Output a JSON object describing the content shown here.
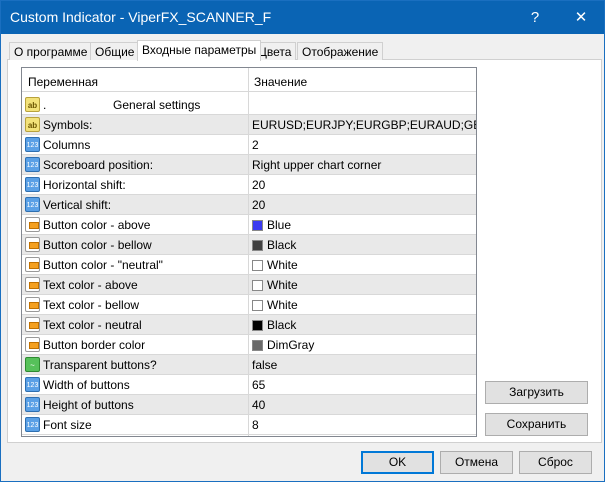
{
  "window": {
    "title": "Custom Indicator - ViperFX_SCANNER_F",
    "help_label": "?",
    "close_label": "✕"
  },
  "tabs": [
    {
      "label": "О программе"
    },
    {
      "label": "Общие"
    },
    {
      "label": "Входные параметры",
      "active": true
    },
    {
      "label": "Цвета"
    },
    {
      "label": "Отображение"
    }
  ],
  "table": {
    "headers": [
      "Переменная",
      "Значение"
    ],
    "rows": [
      {
        "icon": "ab",
        "name": ".                    General settings",
        "value": ""
      },
      {
        "icon": "ab",
        "name": "Symbols:",
        "value": "EURUSD;EURJPY;EURGBP;EURAUD;GB..."
      },
      {
        "icon": "123",
        "name": "Columns",
        "value": "2"
      },
      {
        "icon": "123",
        "name": "Scoreboard position:",
        "value": "Right upper chart corner"
      },
      {
        "icon": "123",
        "name": "Horizontal shift:",
        "value": "20"
      },
      {
        "icon": "123",
        "name": "Vertical shift:",
        "value": "20"
      },
      {
        "icon": "color",
        "name": "Button color - above",
        "value": "Blue",
        "swatch": "#3a3af0"
      },
      {
        "icon": "color",
        "name": "Button color - bellow",
        "value": "Black",
        "swatch": "#404040"
      },
      {
        "icon": "color",
        "name": "Button color - \"neutral\"",
        "value": "White",
        "swatch": "#ffffff"
      },
      {
        "icon": "color",
        "name": "Text color - above",
        "value": "White",
        "swatch": "#ffffff"
      },
      {
        "icon": "color",
        "name": "Text color - bellow",
        "value": "White",
        "swatch": "#ffffff"
      },
      {
        "icon": "color",
        "name": "Text color - neutral",
        "value": "Black",
        "swatch": "#000000"
      },
      {
        "icon": "color",
        "name": "Button border color",
        "value": "DimGray",
        "swatch": "#696969"
      },
      {
        "icon": "bool",
        "name": "Transparent buttons?",
        "value": "false"
      },
      {
        "icon": "123",
        "name": "Width of buttons",
        "value": "65"
      },
      {
        "icon": "123",
        "name": "Height of buttons",
        "value": "40"
      },
      {
        "icon": "123",
        "name": "Font size",
        "value": "8"
      }
    ]
  },
  "side_buttons": {
    "load": "Загрузить",
    "save": "Сохранить"
  },
  "footer": {
    "ok": "OK",
    "cancel": "Отмена",
    "reset": "Сброс"
  },
  "colors": {
    "titlebar": "#0a64b4",
    "accent": "#0078d7"
  }
}
